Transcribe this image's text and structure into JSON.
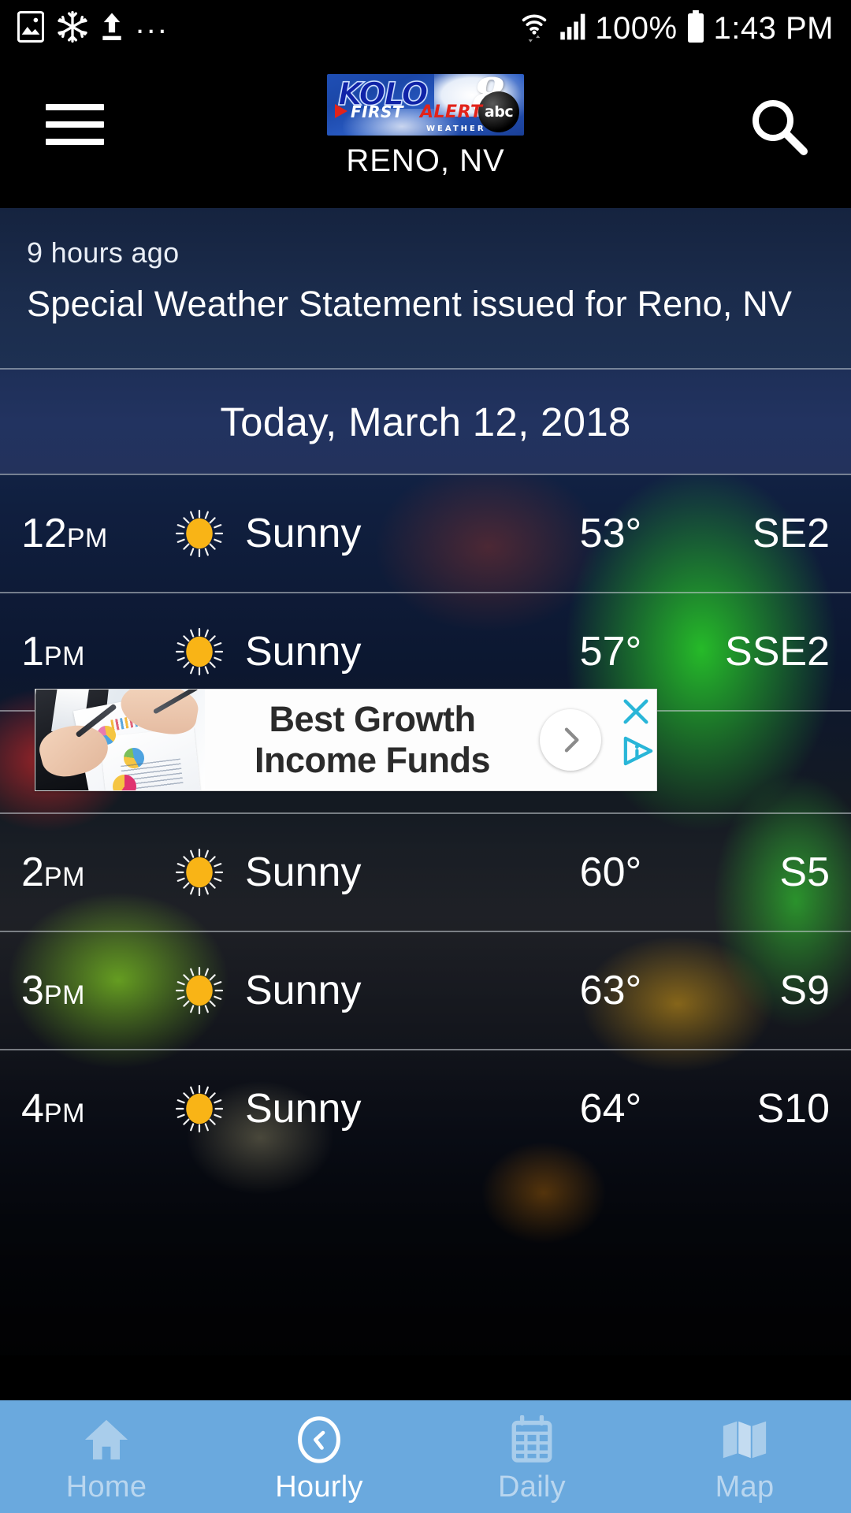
{
  "status_bar": {
    "icons_left": [
      "image-icon",
      "snowflake-icon",
      "upload-icon",
      "more-icon"
    ],
    "dots": "...",
    "battery_pct": "100%",
    "time": "1:43 PM"
  },
  "header": {
    "menu_icon": "hamburger-menu-icon",
    "search_icon": "search-icon",
    "logo": {
      "kolo": "KOLO",
      "channel": "8",
      "network": "abc",
      "first": "FIRST",
      "alert": "ALERT",
      "weather": "WEATHER"
    },
    "city": "RENO, NV"
  },
  "alert": {
    "time_ago": "9 hours ago",
    "title": "Special Weather Statement issued for Reno, NV"
  },
  "date_header": "Today, March 12, 2018",
  "hourly": [
    {
      "time": "12",
      "meridiem": "PM",
      "icon": "sun-icon",
      "condition": "Sunny",
      "temp": "53°",
      "wind": "SE2"
    },
    {
      "time": "1",
      "meridiem": "PM",
      "icon": "sun-icon",
      "condition": "Sunny",
      "temp": "57°",
      "wind": "SSE2"
    },
    {
      "time": "2",
      "meridiem": "PM",
      "icon": "sun-icon",
      "condition": "Sunny",
      "temp": "60°",
      "wind": "S5"
    },
    {
      "time": "3",
      "meridiem": "PM",
      "icon": "sun-icon",
      "condition": "Sunny",
      "temp": "63°",
      "wind": "S9"
    },
    {
      "time": "4",
      "meridiem": "PM",
      "icon": "sun-icon",
      "condition": "Sunny",
      "temp": "64°",
      "wind": "S10"
    }
  ],
  "ad": {
    "line1": "Best Growth",
    "line2": "Income Funds",
    "arrow_icon": "chevron-right-icon",
    "close_icon": "close-x-icon",
    "adchoices_icon": "adchoices-icon",
    "accent_color": "#29b6d8"
  },
  "bottom_nav": {
    "items": [
      {
        "label": "Home",
        "icon": "home-icon",
        "active": false
      },
      {
        "label": "Hourly",
        "icon": "clock-icon",
        "active": true
      },
      {
        "label": "Daily",
        "icon": "calendar-icon",
        "active": false
      },
      {
        "label": "Map",
        "icon": "map-icon",
        "active": false
      }
    ],
    "bar_color": "#6aa9de"
  }
}
